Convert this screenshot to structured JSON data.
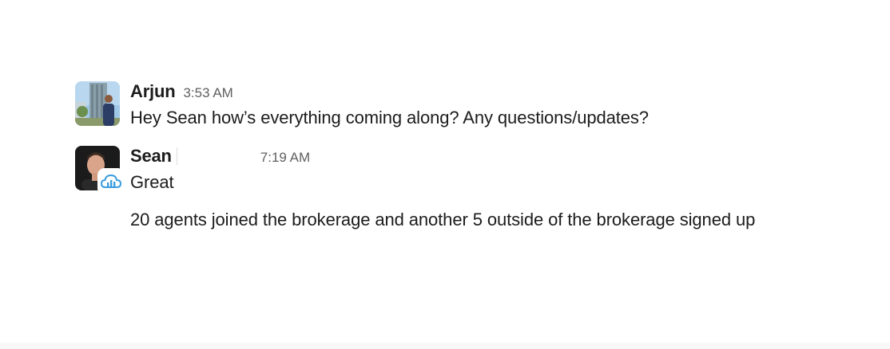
{
  "messages": [
    {
      "author": "Arjun",
      "time": "3:53 AM",
      "lines": [
        "Hey Sean how’s everything coming along? Any questions/updates?"
      ],
      "avatar_icon": "profile-photo-icon"
    },
    {
      "author": "Sean",
      "time": "7:19 AM",
      "lines": [
        "Great",
        "20 agents joined the brokerage and another 5 outside of the brokerage signed up"
      ],
      "avatar_icon": "profile-photo-icon",
      "badge_icon": "cloud-chart-app-icon",
      "badge_color": "#3b9ddd"
    }
  ]
}
